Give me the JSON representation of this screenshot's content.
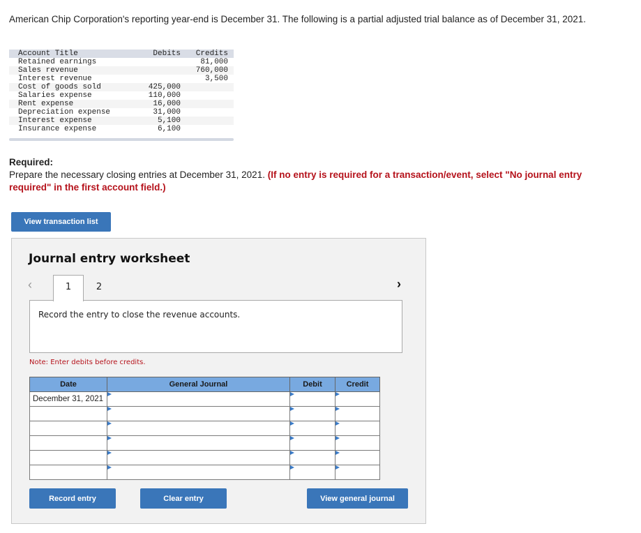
{
  "intro": "American Chip Corporation's reporting year-end is December 31. The following is a partial adjusted trial balance as of December 31, 2021.",
  "trial_balance": {
    "headers": {
      "title": "Account Title",
      "debits": "Debits",
      "credits": "Credits"
    },
    "rows": [
      {
        "title": "Retained earnings",
        "debit": "",
        "credit": "81,000"
      },
      {
        "title": "Sales revenue",
        "debit": "",
        "credit": "760,000"
      },
      {
        "title": "Interest revenue",
        "debit": "",
        "credit": "3,500"
      },
      {
        "title": "Cost of goods sold",
        "debit": "425,000",
        "credit": ""
      },
      {
        "title": "Salaries expense",
        "debit": "110,000",
        "credit": ""
      },
      {
        "title": "Rent expense",
        "debit": "16,000",
        "credit": ""
      },
      {
        "title": "Depreciation expense",
        "debit": "31,000",
        "credit": ""
      },
      {
        "title": "Interest expense",
        "debit": "5,100",
        "credit": ""
      },
      {
        "title": "Insurance expense",
        "debit": "6,100",
        "credit": ""
      }
    ]
  },
  "required": {
    "title": "Required:",
    "text": "Prepare the necessary closing entries at December 31, 2021. ",
    "red_text": "(If no entry is required for a transaction/event, select \"No journal entry required\" in the first account field.)"
  },
  "buttons": {
    "view_transaction_list": "View transaction list",
    "record_entry": "Record entry",
    "clear_entry": "Clear entry",
    "view_general_journal": "View general journal"
  },
  "worksheet": {
    "title": "Journal entry worksheet",
    "prev_icon": "‹",
    "next_icon": "›",
    "tabs": [
      {
        "label": "1",
        "active": true
      },
      {
        "label": "2",
        "active": false
      }
    ],
    "instruction": "Record the entry to close the revenue accounts.",
    "note": "Note: Enter debits before credits.",
    "table": {
      "headers": {
        "date": "Date",
        "general_journal": "General Journal",
        "debit": "Debit",
        "credit": "Credit"
      },
      "rows": [
        {
          "date": "December 31, 2021",
          "account": "",
          "debit": "",
          "credit": ""
        },
        {
          "date": "",
          "account": "",
          "debit": "",
          "credit": ""
        },
        {
          "date": "",
          "account": "",
          "debit": "",
          "credit": ""
        },
        {
          "date": "",
          "account": "",
          "debit": "",
          "credit": ""
        },
        {
          "date": "",
          "account": "",
          "debit": "",
          "credit": ""
        },
        {
          "date": "",
          "account": "",
          "debit": "",
          "credit": ""
        }
      ]
    }
  },
  "colors": {
    "accent": "#3a76b9",
    "header_blue": "#78a9e0",
    "warning_red": "#b5121b"
  }
}
